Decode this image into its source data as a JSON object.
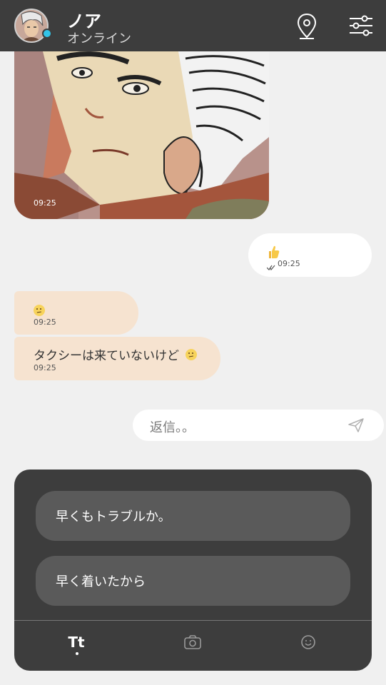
{
  "header": {
    "contact_name": "ノア",
    "status": "オンライン",
    "online": true,
    "icons": [
      "location-pin-icon",
      "settings-sliders-icon"
    ]
  },
  "messages": [
    {
      "type": "image",
      "direction": "incoming",
      "time": "09:25"
    },
    {
      "type": "emoji",
      "direction": "outgoing",
      "emoji": "thumbs-up",
      "time": "09:25",
      "read": true
    },
    {
      "type": "emoji",
      "direction": "incoming",
      "emoji": "confused-face",
      "time": "09:25"
    },
    {
      "type": "text",
      "direction": "incoming",
      "text": "タクシーは来ていないけど",
      "emoji": "confused-face",
      "time": "09:25"
    }
  ],
  "reply": {
    "placeholder": "返信。。"
  },
  "choices": [
    {
      "label": "早くもトラブルか。"
    },
    {
      "label": "早く着いたから"
    }
  ],
  "tabs": [
    {
      "label": "Tt",
      "active": true
    },
    {
      "icon": "camera-icon"
    },
    {
      "icon": "smiley-icon"
    }
  ],
  "colors": {
    "header_bg": "#3d3d3d",
    "incoming_bubble": "#f6e3d0",
    "outgoing_bubble": "#ffffff",
    "online_dot": "#33c4e8",
    "panel_bg": "#3d3d3d",
    "choice_bg": "#5a5a5a"
  }
}
